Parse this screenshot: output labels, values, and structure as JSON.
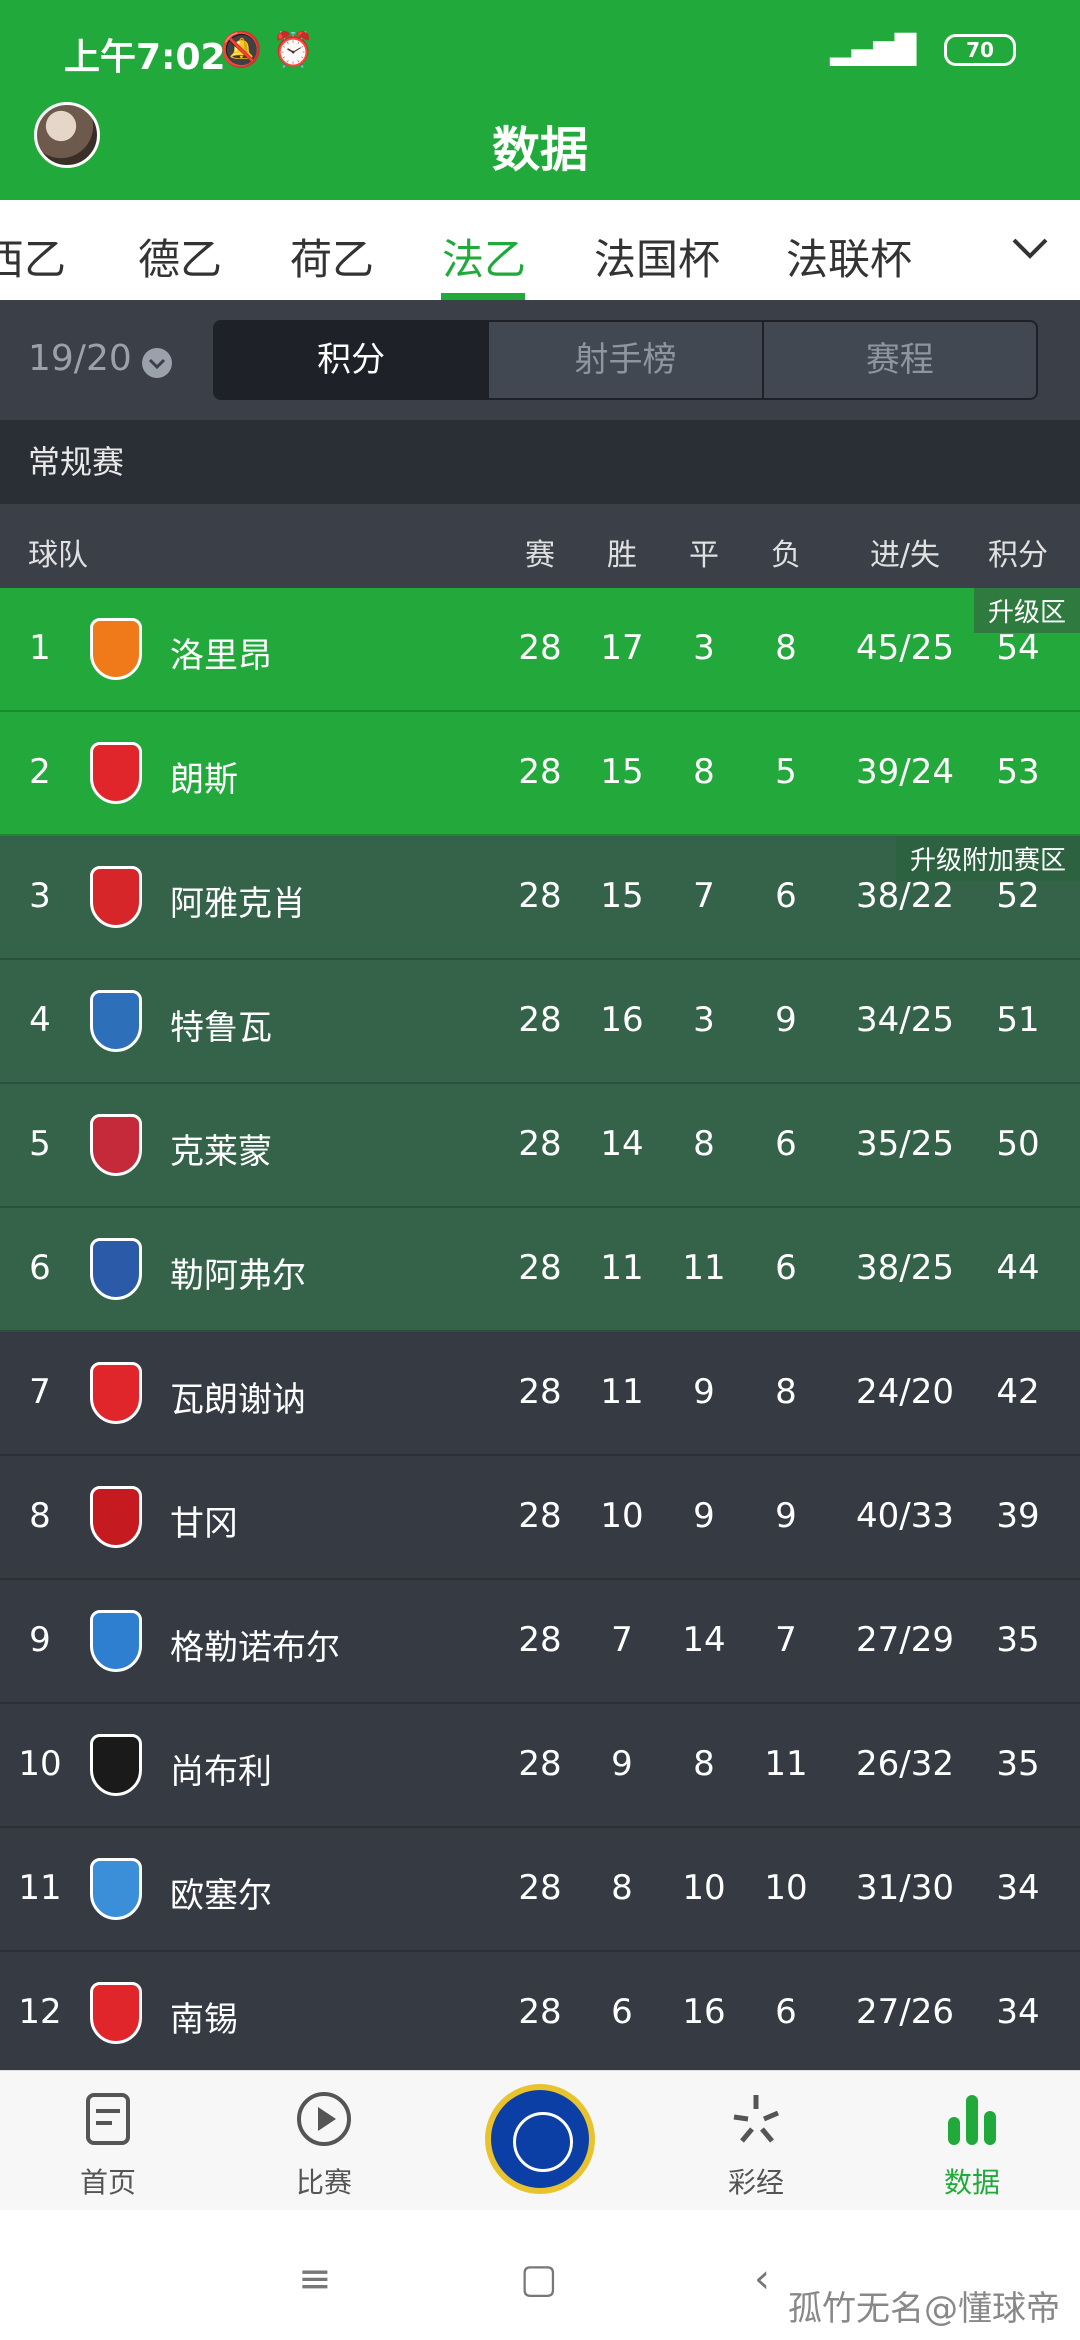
{
  "status": {
    "time": "上午7:02",
    "battery": "70"
  },
  "header": {
    "title": "数据"
  },
  "league_tabs": [
    "西乙",
    "德乙",
    "荷乙",
    "法乙",
    "法国杯",
    "法联杯"
  ],
  "active_tab": "法乙",
  "season": "19/20",
  "segments": [
    "积分",
    "射手榜",
    "赛程"
  ],
  "active_segment": "积分",
  "section_title": "常规赛",
  "table": {
    "headers": {
      "team": "球队",
      "played": "赛",
      "won": "胜",
      "drawn": "平",
      "lost": "负",
      "gd": "进/失",
      "points": "积分"
    },
    "zone_labels": {
      "promotion": "升级区",
      "playoff": "升级附加赛区"
    },
    "rows": [
      {
        "rank": "1",
        "team": "洛里昂",
        "played": "28",
        "won": "17",
        "drawn": "3",
        "lost": "8",
        "gd": "45/25",
        "points": "54",
        "zone": "promo",
        "logo_color": "#f07a1a"
      },
      {
        "rank": "2",
        "team": "朗斯",
        "played": "28",
        "won": "15",
        "drawn": "8",
        "lost": "5",
        "gd": "39/24",
        "points": "53",
        "zone": "promo",
        "logo_color": "#e0262a"
      },
      {
        "rank": "3",
        "team": "阿雅克肖",
        "played": "28",
        "won": "15",
        "drawn": "7",
        "lost": "6",
        "gd": "38/22",
        "points": "52",
        "zone": "playoff",
        "logo_color": "#d6262a"
      },
      {
        "rank": "4",
        "team": "特鲁瓦",
        "played": "28",
        "won": "16",
        "drawn": "3",
        "lost": "9",
        "gd": "34/25",
        "points": "51",
        "zone": "playoff",
        "logo_color": "#2d6fb8"
      },
      {
        "rank": "5",
        "team": "克莱蒙",
        "played": "28",
        "won": "14",
        "drawn": "8",
        "lost": "6",
        "gd": "35/25",
        "points": "50",
        "zone": "playoff",
        "logo_color": "#c42a3a"
      },
      {
        "rank": "6",
        "team": "勒阿弗尔",
        "played": "28",
        "won": "11",
        "drawn": "11",
        "lost": "6",
        "gd": "38/25",
        "points": "44",
        "zone": "playoff",
        "logo_color": "#2b5aa8"
      },
      {
        "rank": "7",
        "team": "瓦朗谢讷",
        "played": "28",
        "won": "11",
        "drawn": "9",
        "lost": "8",
        "gd": "24/20",
        "points": "42",
        "zone": "normal",
        "logo_color": "#e0262a"
      },
      {
        "rank": "8",
        "team": "甘冈",
        "played": "28",
        "won": "10",
        "drawn": "9",
        "lost": "9",
        "gd": "40/33",
        "points": "39",
        "zone": "normal",
        "logo_color": "#c51a20"
      },
      {
        "rank": "9",
        "team": "格勒诺布尔",
        "played": "28",
        "won": "7",
        "drawn": "14",
        "lost": "7",
        "gd": "27/29",
        "points": "35",
        "zone": "normal",
        "logo_color": "#2f7fd0"
      },
      {
        "rank": "10",
        "team": "尚布利",
        "played": "28",
        "won": "9",
        "drawn": "8",
        "lost": "11",
        "gd": "26/32",
        "points": "35",
        "zone": "normal",
        "logo_color": "#1a1a1a"
      },
      {
        "rank": "11",
        "team": "欧塞尔",
        "played": "28",
        "won": "8",
        "drawn": "10",
        "lost": "10",
        "gd": "31/30",
        "points": "34",
        "zone": "normal",
        "logo_color": "#3a8fd8"
      },
      {
        "rank": "12",
        "team": "南锡",
        "played": "28",
        "won": "6",
        "drawn": "16",
        "lost": "6",
        "gd": "27/26",
        "points": "34",
        "zone": "normal",
        "logo_color": "#e0262a"
      }
    ]
  },
  "bottom_nav": [
    {
      "label": "首页",
      "icon": "home-page-icon"
    },
    {
      "label": "比赛",
      "icon": "play-icon"
    },
    {
      "label": "彩经",
      "icon": "star-burst-icon"
    },
    {
      "label": "数据",
      "icon": "bar-chart-icon"
    }
  ],
  "watermark": "孤竹无名@懂球帝",
  "colors": {
    "brand_green": "#22a93b",
    "promo_row": "#23a83b",
    "playoff_row": "#35634a",
    "normal_row": "#353a43"
  }
}
